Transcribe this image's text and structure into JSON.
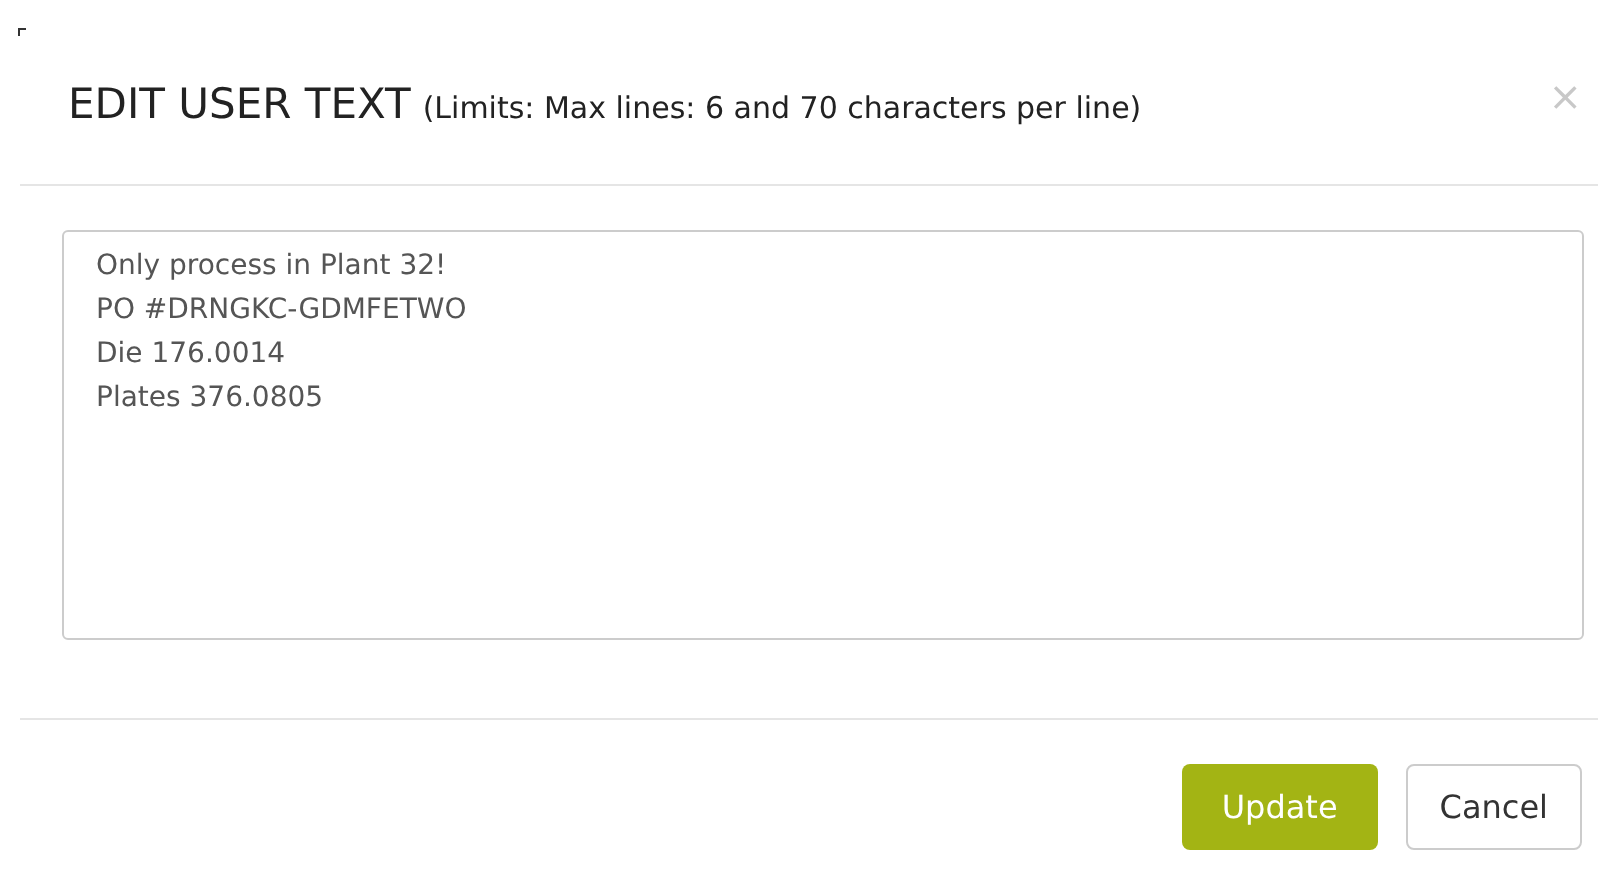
{
  "dialog": {
    "title": "EDIT USER TEXT",
    "subtitle": "(Limits: Max lines: 6 and 70 characters per line)",
    "close": "×"
  },
  "user_text": {
    "value": "Only process in Plant 32!\nPO #DRNGKC-GDMFETWO\nDie 176.0014\nPlates 376.0805"
  },
  "buttons": [
    {
      "label": "Update",
      "kind": "primary"
    },
    {
      "label": "Cancel",
      "kind": "default"
    }
  ]
}
